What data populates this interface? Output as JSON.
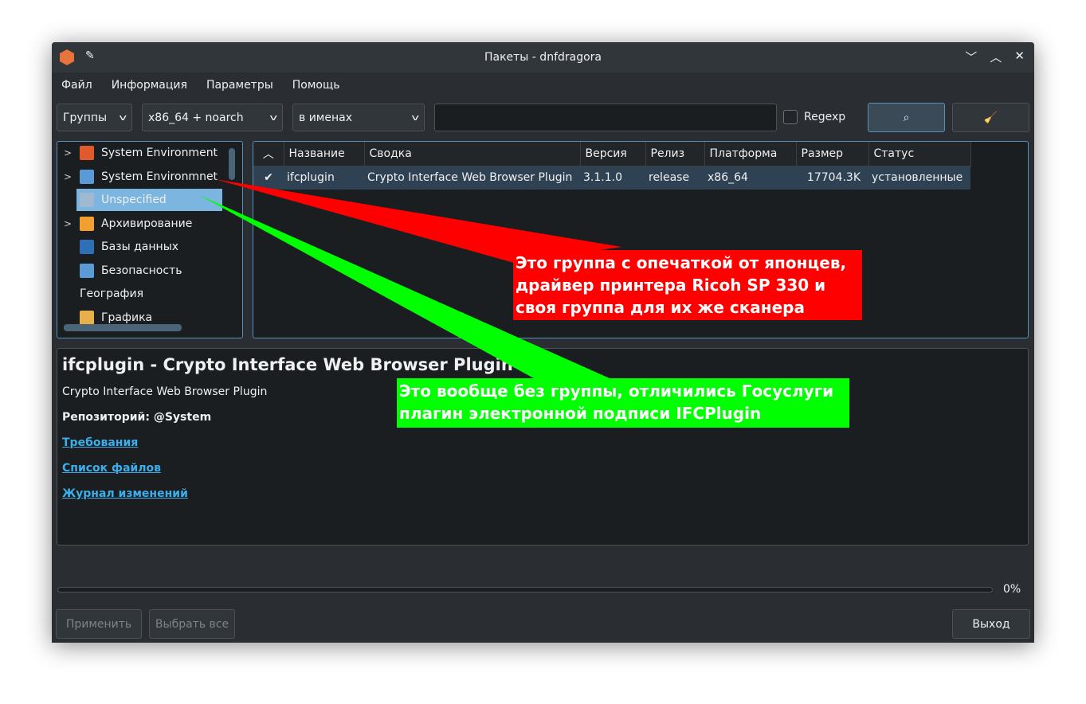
{
  "window": {
    "title": "Пакеты - dnfdragora",
    "icons": [
      "app-icon",
      "pin-icon",
      "minimize-icon",
      "maximize-icon",
      "close-icon"
    ]
  },
  "menu": [
    "Файл",
    "Информация",
    "Параметры",
    "Помощь"
  ],
  "toolbar": {
    "view_combo": "Группы",
    "arch_combo": "x86_64 + noarch",
    "search_in_combo": "в именах",
    "search_value": "",
    "regexp_label": "Regexp",
    "regexp_checked": false
  },
  "tree": [
    {
      "label": "System Environment",
      "icon": "tools-icon",
      "expandable": true
    },
    {
      "label": "System Environmnet",
      "icon": "monitor-icon",
      "expandable": true
    },
    {
      "label": "Unspecified",
      "icon": "folder-icon",
      "expandable": false,
      "selected": true
    },
    {
      "label": "Архивирование",
      "icon": "archive-icon",
      "expandable": true
    },
    {
      "label": "Базы данных",
      "icon": "database-icon",
      "expandable": false
    },
    {
      "label": "Безопасность",
      "icon": "monitor-icon",
      "expandable": false
    },
    {
      "label": "География",
      "icon": "",
      "expandable": false
    },
    {
      "label": "Графика",
      "icon": "graphics-icon",
      "expandable": false
    }
  ],
  "table": {
    "columns": [
      "Название",
      "Сводка",
      "Версия",
      "Релиз",
      "Платформа",
      "Размер",
      "Статус"
    ],
    "rows": [
      {
        "checked": true,
        "cells": [
          "ifcplugin",
          "Crypto Interface Web Browser Plugin",
          "3.1.1.0",
          "release",
          "x86_64",
          "17704.3K",
          "установленные"
        ]
      }
    ]
  },
  "details": {
    "title": "ifcplugin - Crypto Interface Web Browser Plugin",
    "summary": "Crypto Interface Web Browser Plugin",
    "repo": "Репозиторий: @System",
    "links": [
      "Требования",
      "Список файлов",
      "Журнал изменений"
    ]
  },
  "progress": {
    "value": 0,
    "label": "0%"
  },
  "buttons": {
    "apply": "Применить",
    "select_all": "Выбрать все",
    "exit": "Выход"
  },
  "annotations": {
    "red": {
      "lines": [
        "Это группа с опечаткой от японцев,",
        "драйвер принтера Ricoh SP 330 и",
        "своя группа для их же сканера"
      ],
      "color": "#ff0000"
    },
    "green": {
      "lines": [
        "Это вообще без группы, отличились Госуслуги",
        "плагин электронной подписи IFCPlugin"
      ],
      "color": "#00ff00"
    }
  }
}
